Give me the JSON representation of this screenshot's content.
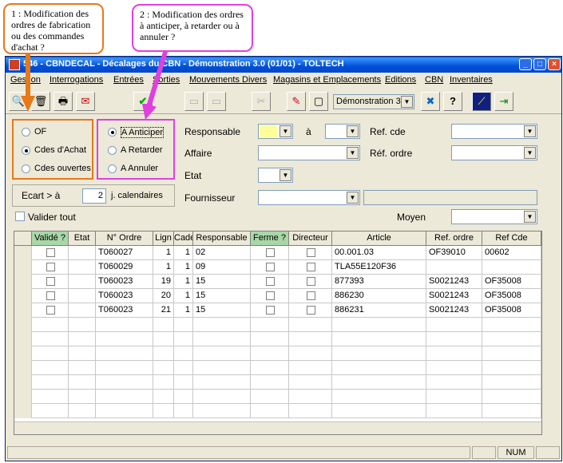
{
  "callouts": {
    "one": "1 : Modification des ordres de fabrication ou des commandes d'achat ?",
    "two": "2 : Modification des ordres à anticiper, à retarder ou à annuler ?"
  },
  "window": {
    "title": "546 - CBNDECAL - Décalages du CBN - Démonstration 3.0 (01/01) - TOLTECH",
    "btn_min": "_",
    "btn_max": "□",
    "btn_close": "×"
  },
  "menu": [
    "Gestion",
    "Interrogations",
    "Entrées",
    "Sorties",
    "Mouvements Divers",
    "Magasins et Emplacements",
    "Editions",
    "CBN",
    "Inventaires"
  ],
  "toolbar": {
    "company": "Démonstration 3",
    "icons": [
      "preview-icon",
      "delete-icon",
      "print-icon",
      "mail-icon",
      "validate-icon",
      "disabled-icon",
      "disabled-icon",
      "cut-icon",
      "eraser-icon",
      "new-document-icon",
      "company-combo",
      "tools-icon",
      "help-icon",
      "chart-icon",
      "exit-icon"
    ]
  },
  "type_group": {
    "options": [
      "OF",
      "Cdes d'Achat",
      "Cdes ouvertes"
    ],
    "selected": 1
  },
  "action_group": {
    "options": [
      "A Anticiper",
      "A Retarder",
      "A Annuler"
    ],
    "selected": 0
  },
  "ecart": {
    "label": "Ecart > à",
    "value": "2",
    "unit": "j. calendaires"
  },
  "valider_tout": "Valider tout",
  "filters": {
    "responsable": "Responsable",
    "a": "à",
    "affaire": "Affaire",
    "etat": "Etat",
    "fournisseur": "Fournisseur",
    "ref_cde": "Ref. cde",
    "ref_ordre": "Réf. ordre",
    "moyen": "Moyen"
  },
  "grid": {
    "columns": [
      "Validé ?",
      "Etat",
      "N° Ordre",
      "Lign",
      "Cade",
      "Responsable",
      "Ferme ?",
      "Directeur",
      "Article",
      "Ref. ordre",
      "Ref Cde"
    ],
    "rows": [
      {
        "ordre": "T060027",
        "lign": "1",
        "cade": "1",
        "resp": "02",
        "article": "00.001.03",
        "ref_ordre": "OF39010",
        "ref_cde": "00602"
      },
      {
        "ordre": "T060029",
        "lign": "1",
        "cade": "1",
        "resp": "09",
        "article": "TLA55E120F36",
        "ref_ordre": "",
        "ref_cde": ""
      },
      {
        "ordre": "T060023",
        "lign": "19",
        "cade": "1",
        "resp": "15",
        "article": "877393",
        "ref_ordre": "S0021243",
        "ref_cde": "OF35008"
      },
      {
        "ordre": "T060023",
        "lign": "20",
        "cade": "1",
        "resp": "15",
        "article": "886230",
        "ref_ordre": "S0021243",
        "ref_cde": "OF35008"
      },
      {
        "ordre": "T060023",
        "lign": "21",
        "cade": "1",
        "resp": "15",
        "article": "886231",
        "ref_ordre": "S0021243",
        "ref_cde": "OF35008"
      }
    ]
  },
  "status": {
    "num": "NUM"
  },
  "colors": {
    "callout1": "#e87818",
    "callout2": "#e040e0",
    "responsable_field": "#ffff99"
  }
}
